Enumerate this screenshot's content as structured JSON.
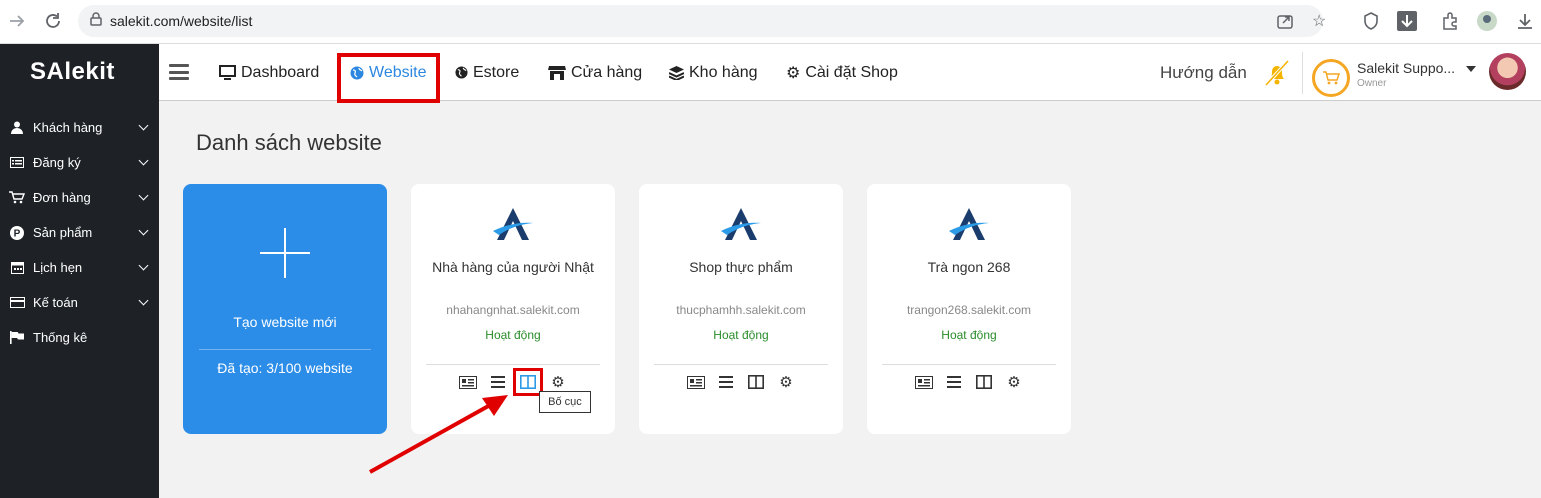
{
  "browser": {
    "url": "salekit.com/website/list"
  },
  "sidebar": {
    "logo": "SAlekit",
    "items": [
      {
        "label": "Khách hàng",
        "icon": "user-icon"
      },
      {
        "label": "Đăng ký",
        "icon": "list-card-icon"
      },
      {
        "label": "Đơn hàng",
        "icon": "cart-icon"
      },
      {
        "label": "Sản phẩm",
        "icon": "product-p-icon"
      },
      {
        "label": "Lịch hẹn",
        "icon": "calendar-icon"
      },
      {
        "label": "Kế toán",
        "icon": "credit-card-icon"
      },
      {
        "label": "Thống kê",
        "icon": "flag-icon"
      }
    ]
  },
  "topbar": {
    "nav": [
      {
        "label": "Dashboard",
        "icon": "monitor-icon"
      },
      {
        "label": "Website",
        "icon": "globe-icon"
      },
      {
        "label": "Estore",
        "icon": "globe-icon"
      },
      {
        "label": "Cửa hàng",
        "icon": "store-icon"
      },
      {
        "label": "Kho hàng",
        "icon": "layers-icon"
      },
      {
        "label": "Cài đặt Shop",
        "icon": "gear-icon"
      }
    ],
    "help": "Hướng dẫn",
    "user_name": "Salekit Suppo...",
    "user_role": "Owner"
  },
  "main": {
    "title": "Danh sách website",
    "new_card": {
      "label": "Tạo website mới",
      "count": "Đã tạo: 3/100 website"
    },
    "websites": [
      {
        "name": "Nhà hàng của người Nhật",
        "domain": "nhahangnhat.salekit.com",
        "status": "Hoạt động"
      },
      {
        "name": "Shop thực phẩm",
        "domain": "thucphamhh.salekit.com",
        "status": "Hoạt động"
      },
      {
        "name": "Trà ngon 268",
        "domain": "trangon268.salekit.com",
        "status": "Hoạt động"
      }
    ],
    "tooltip": "Bố cục"
  },
  "colors": {
    "accent": "#2b8de8",
    "sidebar": "#1e2227",
    "status": "#2a8c2a",
    "highlight": "#e00000"
  }
}
